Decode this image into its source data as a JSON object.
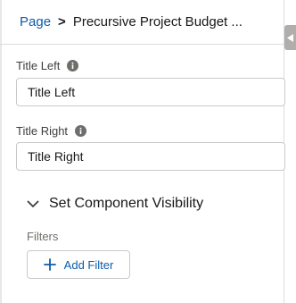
{
  "breadcrumb": {
    "root": "Page",
    "separator": ">",
    "current": "Precursive Project Budget ..."
  },
  "fields": [
    {
      "label": "Title Left",
      "value": "Title Left"
    },
    {
      "label": "Title Right",
      "value": "Title Right"
    }
  ],
  "visibility": {
    "section_title": "Set Component Visibility",
    "filters_label": "Filters",
    "add_filter_label": "Add Filter"
  },
  "icons": {
    "info": "info-icon",
    "chevron": "chevron-down-icon",
    "add": "plus-icon",
    "collapse": "collapse-arrow-icon"
  },
  "colors": {
    "link": "#0b5cab",
    "info_icon": "#706e6b",
    "collapse_tab": "#b0adab"
  }
}
